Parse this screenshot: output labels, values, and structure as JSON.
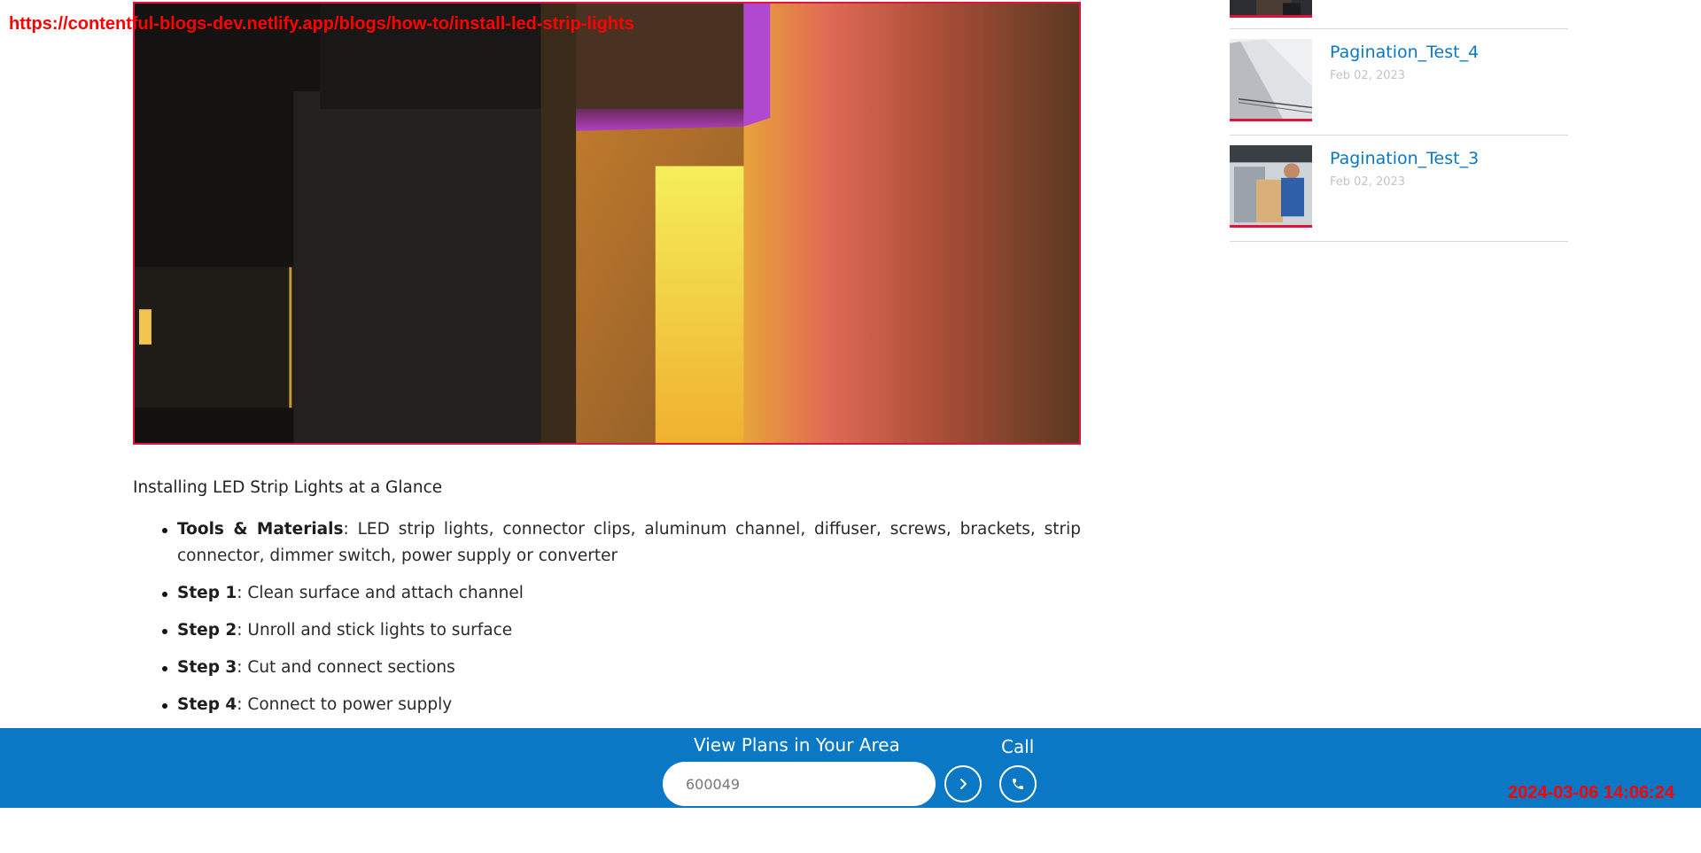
{
  "overlay": {
    "url": "https://contentful-blogs-dev.netlify.app/blogs/how-to/install-led-strip-lights",
    "timestamp": "2024-03-06 14:06:24"
  },
  "article": {
    "heading": "Installing LED Strip Lights at a Glance",
    "items": [
      {
        "label": "Tools & Materials",
        "text": "LED strip lights, connector clips, aluminum channel, diffuser, screws, brackets, strip connector, dimmer switch, power supply or converter"
      },
      {
        "label": "Step 1",
        "text": "Clean surface and attach channel"
      },
      {
        "label": "Step 2",
        "text": "Unroll and stick lights to surface"
      },
      {
        "label": "Step 3",
        "text": "Cut and connect sections"
      },
      {
        "label": "Step 4",
        "text": "Connect to power supply"
      }
    ]
  },
  "sidebar": {
    "items": [
      {
        "title": "Pagination_Test_4",
        "date": "Feb 02, 2023"
      },
      {
        "title": "Pagination_Test_3",
        "date": "Feb 02, 2023"
      }
    ]
  },
  "plan_bar": {
    "label": "View Plans in Your Area",
    "zip_value": "600049",
    "call_label": "Call"
  },
  "colors": {
    "accent_blue": "#0a78c4",
    "accent_red": "#e0143c",
    "overlay_red": "#ff0000"
  },
  "icons": [
    "chevron-right-icon",
    "phone-icon"
  ]
}
